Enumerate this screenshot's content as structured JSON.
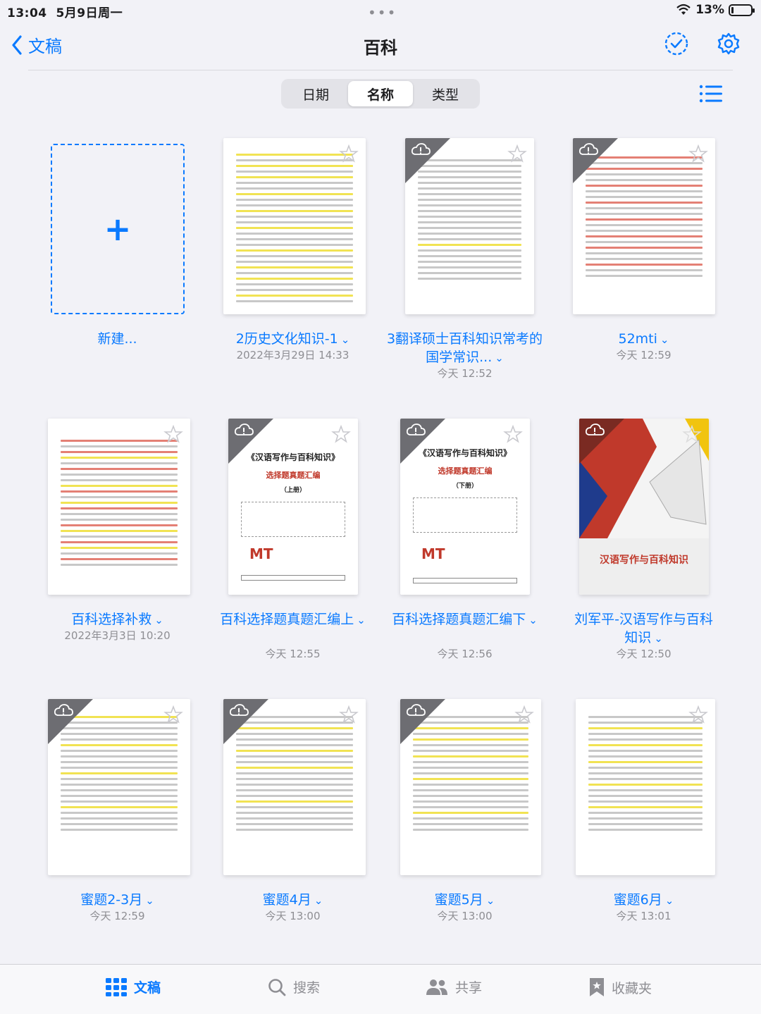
{
  "status": {
    "time": "13:04",
    "date": "5月9日周一",
    "battery": "13%",
    "battery_level": 0.13
  },
  "nav": {
    "back_label": "文稿",
    "title": "百科"
  },
  "sort": {
    "options": [
      "日期",
      "名称",
      "类型"
    ],
    "selected": "名称"
  },
  "new_item": {
    "label": "新建..."
  },
  "documents": [
    {
      "name": "2历史文化知识-1",
      "date": "2022年3月29日 14:33",
      "cloud": false
    },
    {
      "name": "3翻译硕士百科知识常考的国学常识...",
      "date": "今天 12:52",
      "cloud": true
    },
    {
      "name": "52mti",
      "date": "今天 12:59",
      "cloud": true
    },
    {
      "name": "百科选择补救",
      "date": "2022年3月3日 10:20",
      "cloud": false
    },
    {
      "name": "百科选择题真题汇编上",
      "date": "今天 12:55",
      "cloud": true,
      "cover_title": "《汉语写作与百科知识》",
      "cover_sub": "选择题真题汇编",
      "cover_vol": "（上册）"
    },
    {
      "name": "百科选择题真题汇编下",
      "date": "今天 12:56",
      "cloud": true,
      "cover_title": "《汉语写作与百科知识》",
      "cover_sub": "选择题真题汇编",
      "cover_vol": "（下册）"
    },
    {
      "name": "刘军平-汉语写作与百科知识",
      "date": "今天 12:50",
      "cloud": true,
      "cover_title": "汉语写作与百科知识"
    },
    {
      "name": "蜜题2-3月",
      "date": "今天 12:59",
      "cloud": true
    },
    {
      "name": "蜜题4月",
      "date": "今天 13:00",
      "cloud": true
    },
    {
      "name": "蜜题5月",
      "date": "今天 13:00",
      "cloud": true
    },
    {
      "name": "蜜题6月",
      "date": "今天 13:01",
      "cloud": false
    }
  ],
  "tabs": [
    {
      "label": "文稿",
      "icon": "grid-icon",
      "active": true
    },
    {
      "label": "搜索",
      "icon": "search-icon",
      "active": false
    },
    {
      "label": "共享",
      "icon": "people-icon",
      "active": false
    },
    {
      "label": "收藏夹",
      "icon": "bookmark-icon",
      "active": false
    }
  ],
  "colors": {
    "accent": "#0a7aff",
    "background": "#f2f2f7"
  }
}
